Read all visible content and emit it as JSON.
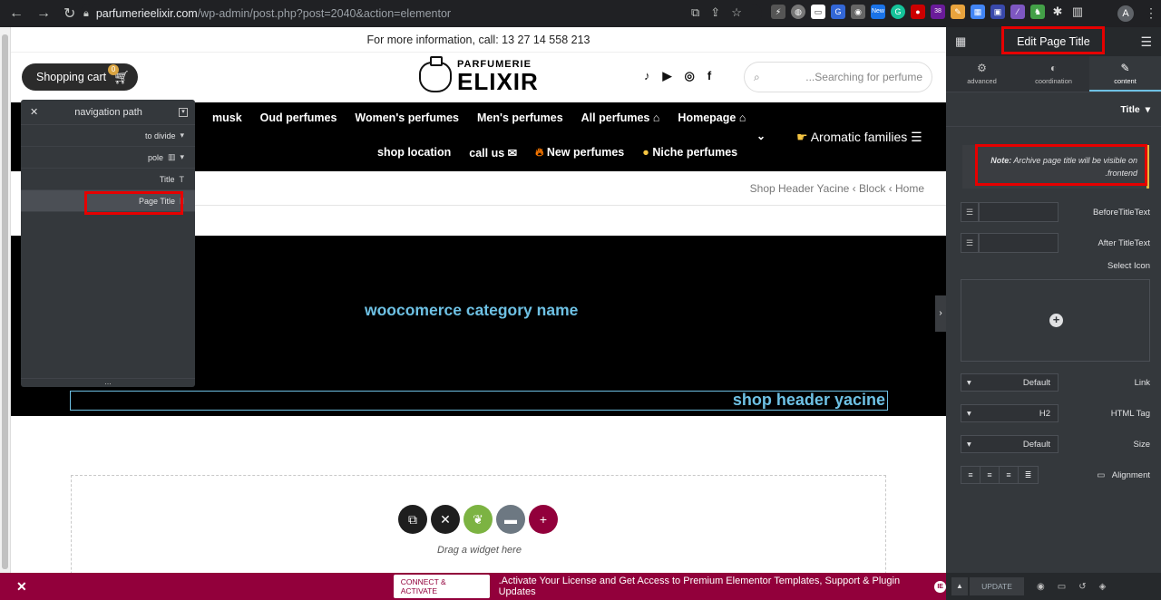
{
  "browser": {
    "url_domain": "parfumerieelixir.com",
    "url_path": "/wp-admin/post.php?post=2040&action=elementor",
    "ext_badge_new": "New",
    "ext_badge_count": "38",
    "avatar_letter": "A"
  },
  "site": {
    "topbar_text": "For more information, call: 13 27 14 558 213",
    "cart_label": "Shopping cart",
    "cart_count": "0",
    "logo_small": "PARFUMERIE",
    "logo_big": "ELIXIR",
    "search_placeholder": "...Searching for perfume",
    "nav_row1": [
      "musk",
      "Oud perfumes",
      "Women's perfumes",
      "Men's perfumes",
      "All perfumes",
      "Homepage"
    ],
    "nav_row2": [
      "shop location",
      "call us",
      "New perfumes",
      "Niche perfumes"
    ],
    "aromatic": "Aromatic families",
    "breadcrumb": [
      "Shop Header Yacine",
      "Block",
      "Home"
    ],
    "hero_category": "woocomerce category name",
    "hero_title": "shop header yacine",
    "drag_label": "Drag a widget here"
  },
  "navigator": {
    "title": "navigation path",
    "rows": [
      {
        "label": "to divide"
      },
      {
        "label": "pole"
      },
      {
        "label": "Title"
      },
      {
        "label": "Page Title"
      }
    ],
    "footer": "..."
  },
  "panel": {
    "title": "Edit Page Title",
    "tabs": [
      "advanced",
      "coordination",
      "content"
    ],
    "section": "Title",
    "note_bold": "Note:",
    "note_text": " Archive page title will be visible on",
    "note_text2": ".frontend",
    "before_label": "BeforeTitleText",
    "after_label": "After TitleText",
    "select_icon_label": "Select Icon",
    "link_label": "Link",
    "link_value": "Default",
    "html_tag_label": "HTML Tag",
    "html_tag_value": "H2",
    "size_label": "Size",
    "size_value": "Default",
    "alignment_label": "Alignment",
    "update_label": "UPDATE"
  },
  "promo": {
    "button": "CONNECT & ACTIVATE",
    "text": ".Activate Your License and Get Access to Premium Elementor Templates, Support & Plugin Updates"
  },
  "colors": {
    "accent": "#6ec1e4",
    "highlight": "#e60000",
    "promo_bg": "#92003b",
    "panel_bg": "#34383c"
  }
}
